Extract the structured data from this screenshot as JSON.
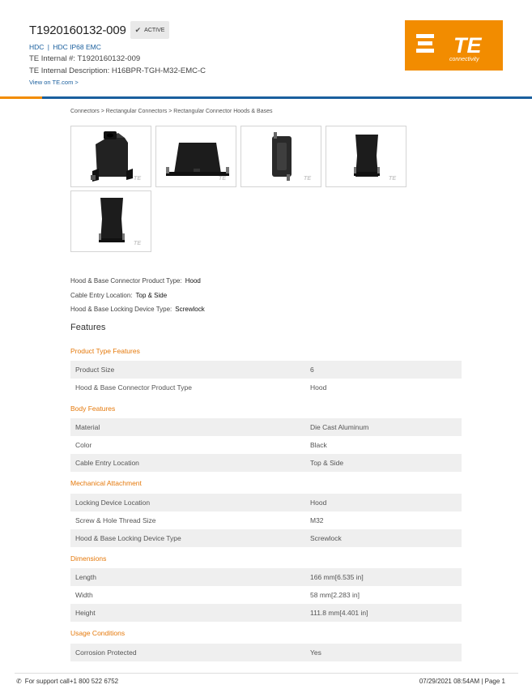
{
  "header": {
    "part_number": "T1920160132-009",
    "status": "ACTIVE",
    "link_1": "HDC",
    "link_2": "HDC IP68 EMC",
    "internal_number": "TE Internal #: T1920160132-009",
    "internal_description": "TE Internal Description: H16BPR-TGH-M32-EMC-C",
    "view_link": "View on TE.com >"
  },
  "logo": {
    "text": "TE",
    "subtext": "connectivity",
    "color": "#f28c00"
  },
  "breadcrumb": {
    "items": [
      "Connectors",
      "Rectangular Connectors",
      "Rectangular Connector Hoods & Bases"
    ],
    "separator": ">"
  },
  "gallery": {
    "watermark": "TE",
    "count": 5
  },
  "summary": [
    {
      "label": "Hood & Base Connector Product Type:",
      "value": "Hood"
    },
    {
      "label": "Cable Entry Location:",
      "value": "Top & Side"
    },
    {
      "label": "Hood & Base Locking Device Type:",
      "value": "Screwlock"
    }
  ],
  "features_title": "Features",
  "sections": [
    {
      "title": "Product Type Features",
      "rows": [
        {
          "k": "Product Size",
          "v": "6"
        },
        {
          "k": "Hood & Base Connector Product Type",
          "v": "Hood"
        }
      ]
    },
    {
      "title": "Body Features",
      "rows": [
        {
          "k": "Material",
          "v": "Die Cast Aluminum"
        },
        {
          "k": "Color",
          "v": "Black"
        },
        {
          "k": "Cable Entry Location",
          "v": "Top & Side"
        }
      ]
    },
    {
      "title": "Mechanical Attachment",
      "rows": [
        {
          "k": "Locking Device Location",
          "v": "Hood"
        },
        {
          "k": "Screw & Hole Thread Size",
          "v": "M32"
        },
        {
          "k": "Hood & Base Locking Device Type",
          "v": "Screwlock"
        }
      ]
    },
    {
      "title": "Dimensions",
      "rows": [
        {
          "k": "Length",
          "v": "166 mm[6.535 in]"
        },
        {
          "k": "Width",
          "v": "58 mm[2.283 in]"
        },
        {
          "k": "Height",
          "v": "111.8 mm[4.401 in]"
        }
      ]
    },
    {
      "title": "Usage Conditions",
      "rows": [
        {
          "k": "Corrosion Protected",
          "v": "Yes"
        }
      ]
    }
  ],
  "footer": {
    "support": "For support call+1 800 522 6752",
    "date_page": "07/29/2021 08:54AM | Page 1"
  },
  "colors": {
    "accent": "#e5790b",
    "link": "#1a5f9e",
    "row_shade": "#efefef"
  }
}
